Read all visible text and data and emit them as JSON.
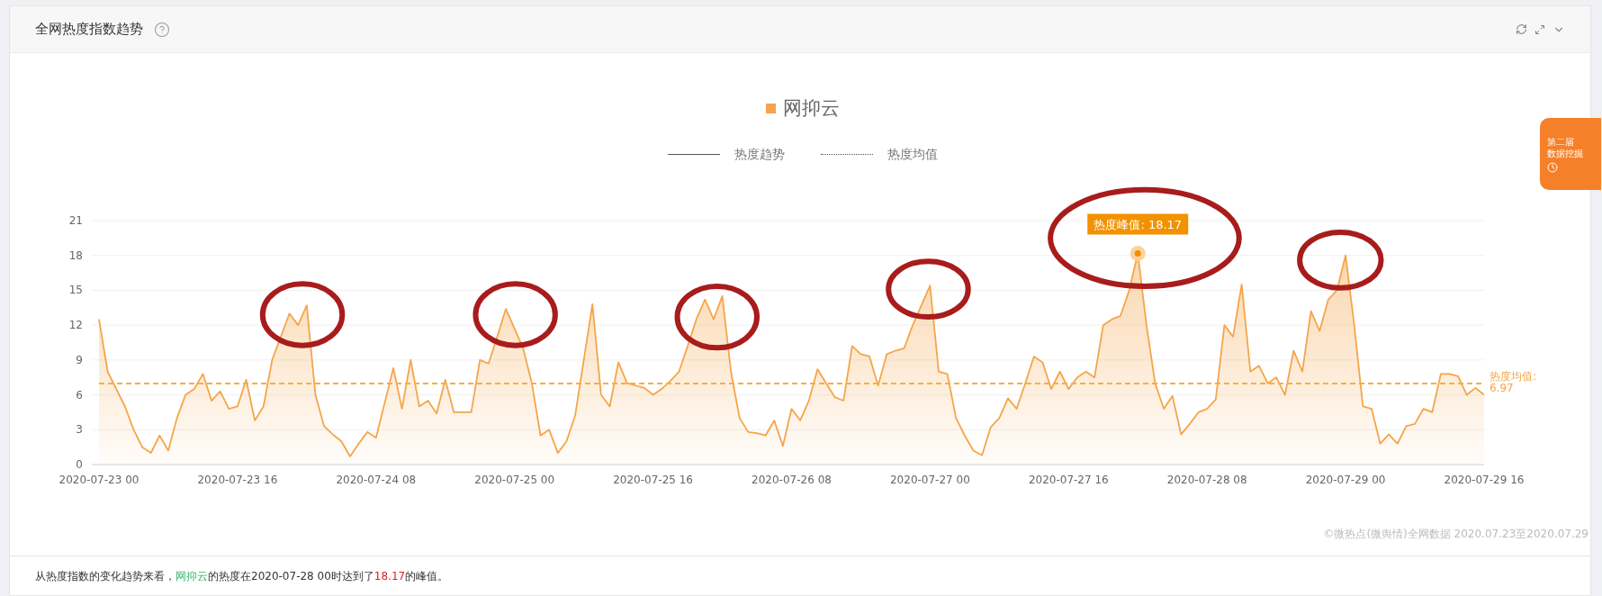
{
  "header": {
    "title": "全网热度指数趋势"
  },
  "legend": {
    "items": [
      {
        "label": "热度趋势",
        "kind": "solid"
      },
      {
        "label": "热度均值",
        "kind": "dotted"
      }
    ]
  },
  "chart_data": {
    "type": "area",
    "ylim": [
      0,
      21
    ],
    "yticks": [
      0,
      3,
      6,
      9,
      12,
      15,
      18,
      21
    ],
    "categories": [
      "2020-07-23 00",
      null,
      null,
      null,
      null,
      null,
      null,
      null,
      null,
      null,
      null,
      null,
      null,
      null,
      null,
      null,
      "2020-07-23 16",
      null,
      null,
      null,
      null,
      null,
      null,
      null,
      null,
      null,
      null,
      null,
      null,
      null,
      null,
      null,
      "2020-07-24 08",
      null,
      null,
      null,
      null,
      null,
      null,
      null,
      null,
      null,
      null,
      null,
      null,
      null,
      null,
      null,
      "2020-07-25 00",
      null,
      null,
      null,
      null,
      null,
      null,
      null,
      null,
      null,
      null,
      null,
      null,
      null,
      null,
      null,
      "2020-07-25 16",
      null,
      null,
      null,
      null,
      null,
      null,
      null,
      null,
      null,
      null,
      null,
      null,
      null,
      null,
      null,
      "2020-07-26 08",
      null,
      null,
      null,
      null,
      null,
      null,
      null,
      null,
      null,
      null,
      null,
      null,
      null,
      null,
      null,
      "2020-07-27 00",
      null,
      null,
      null,
      null,
      null,
      null,
      null,
      null,
      null,
      null,
      null,
      null,
      null,
      null,
      null,
      "2020-07-27 16",
      null,
      null,
      null,
      null,
      null,
      null,
      null,
      null,
      null,
      null,
      null,
      null,
      null,
      null,
      null,
      "2020-07-28 08",
      null,
      null,
      null,
      null,
      null,
      null,
      null,
      null,
      null,
      null,
      null,
      null,
      null,
      null,
      null,
      "2020-07-29 00",
      null,
      null,
      null,
      null,
      null,
      null,
      null,
      null,
      null,
      null,
      null,
      null,
      null,
      null,
      null,
      "2020-07-29 16"
    ],
    "series": [
      {
        "name": "网抑云",
        "color": "#f5a54a",
        "values": [
          12.5,
          8,
          6.5,
          5,
          3,
          1.5,
          1,
          2.5,
          1.2,
          4,
          6,
          6.5,
          7.8,
          5.5,
          6.3,
          4.8,
          5,
          7.3,
          3.8,
          5,
          9,
          11,
          13,
          12,
          13.7,
          6,
          3.3,
          2.6,
          2,
          0.7,
          1.8,
          2.8,
          2.3,
          5.3,
          8.3,
          4.8,
          9,
          5,
          5.5,
          4.4,
          7.3,
          4.5,
          4.5,
          4.5,
          9,
          8.7,
          11,
          13.4,
          11.7,
          10,
          7,
          2.5,
          3,
          1,
          2,
          4.2,
          9,
          13.8,
          6,
          5,
          8.8,
          7,
          6.8,
          6.6,
          6,
          6.5,
          7.2,
          8,
          10.2,
          12.5,
          14.2,
          12.5,
          14.5,
          8,
          4,
          2.8,
          2.7,
          2.5,
          3.8,
          1.6,
          4.8,
          3.8,
          5.5,
          8.2,
          7,
          5.8,
          5.5,
          10.2,
          9.5,
          9.3,
          6.8,
          9.5,
          9.8,
          10,
          12,
          13.7,
          15.4,
          8,
          7.8,
          4,
          2.5,
          1.2,
          0.8,
          3.2,
          4,
          5.7,
          4.8,
          7,
          9.3,
          8.8,
          6.5,
          8,
          6.5,
          7.5,
          8,
          7.5,
          12,
          12.5,
          12.8,
          15,
          18.17,
          12,
          7,
          4.8,
          5.9,
          2.6,
          3.5,
          4.5,
          4.8,
          5.6,
          12,
          11,
          15.5,
          8,
          8.5,
          7,
          7.5,
          6,
          9.8,
          8,
          13.2,
          11.5,
          14.2,
          15,
          18,
          12,
          5,
          4.8,
          1.8,
          2.6,
          1.8,
          3.3,
          3.5,
          4.8,
          4.5,
          7.8,
          7.8,
          7.6,
          6,
          6.6,
          6
        ]
      }
    ],
    "ref_lines": [
      {
        "axis": "y",
        "value": 6.97,
        "label": "热度均值: 6.97"
      }
    ],
    "annotations": [
      {
        "y": 18.17,
        "text": "热度峰值: 18.17"
      }
    ],
    "grid": true
  },
  "promo": {
    "lines": [
      "第二届",
      "数据挖掘"
    ]
  },
  "source_note": "©微热点(微舆情)全网数据 2020.07.23至2020.07.29",
  "summary": {
    "prefix": "从热度指数的变化趋势来看，",
    "name": "网抑云",
    "middle": "的热度在2020-07-28 00时达到了",
    "value": "18.17",
    "suffix": "的峰值。"
  }
}
